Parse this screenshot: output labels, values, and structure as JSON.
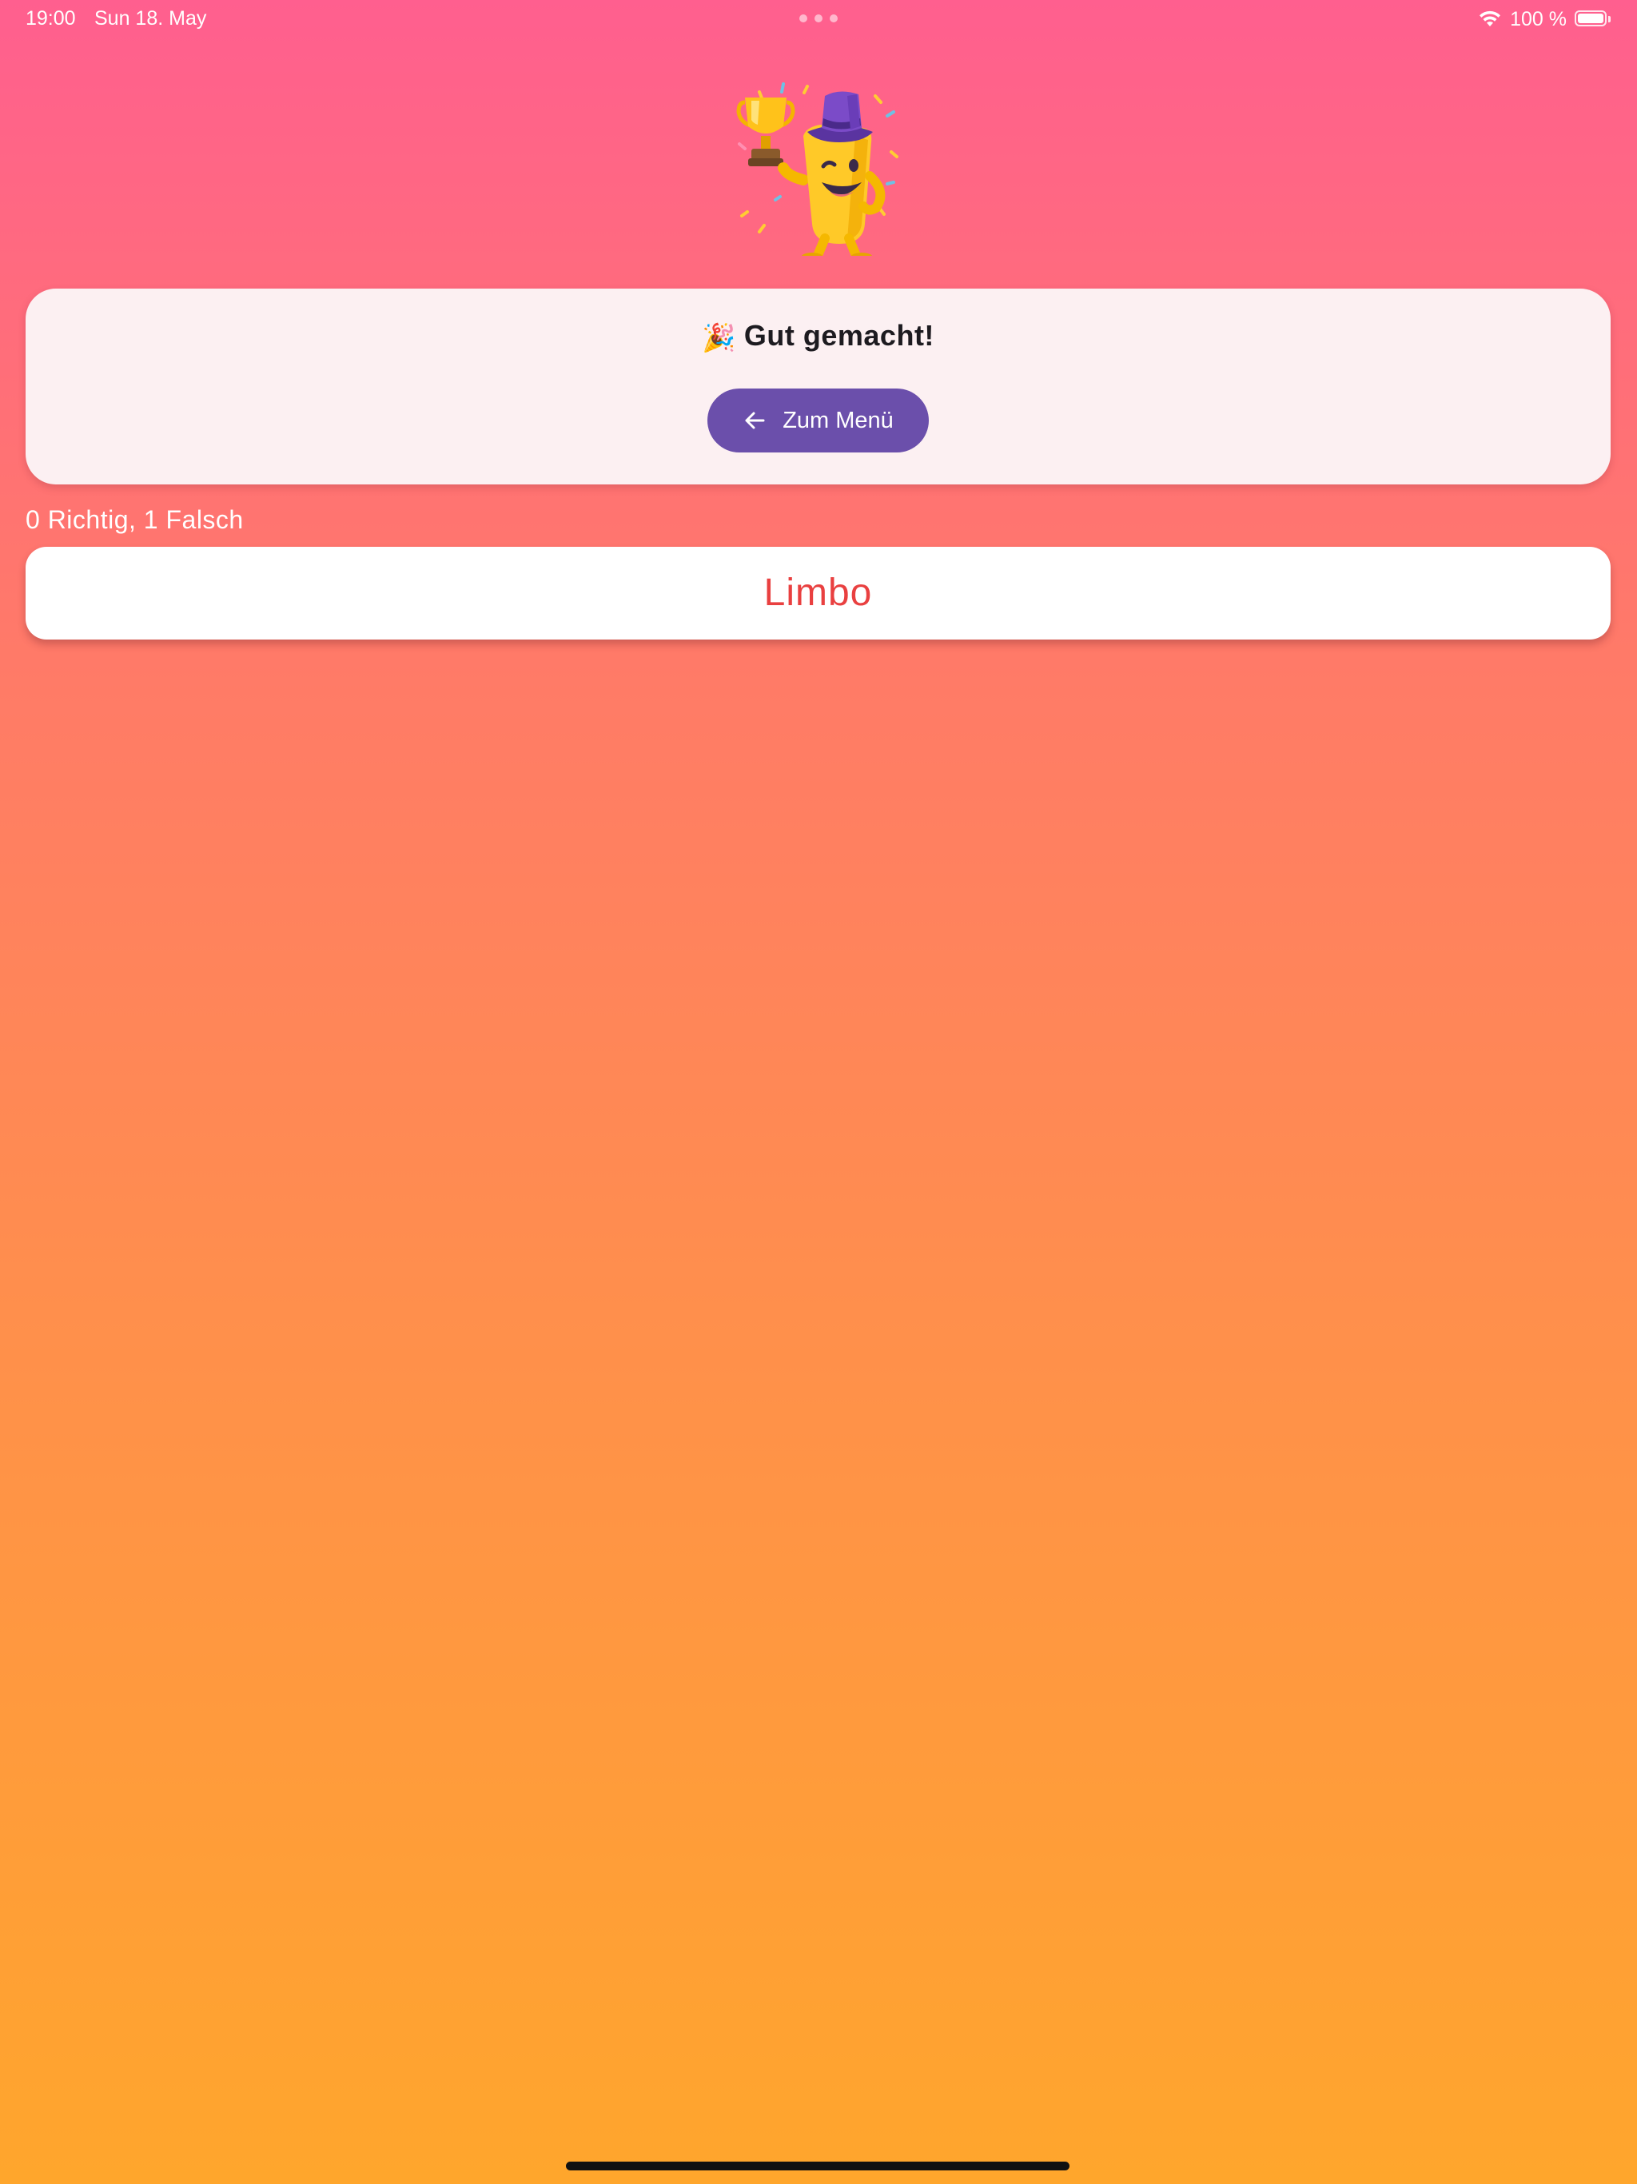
{
  "status_bar": {
    "time": "19:00",
    "date": "Sun 18. May",
    "battery_label": "100 %",
    "battery_level": 1.0
  },
  "mascot": {
    "icon": "trophy-mascot-icon"
  },
  "result_card": {
    "emoji": "🎉",
    "title": "Gut gemacht!",
    "menu_button_label": "Zum Menü",
    "menu_button_icon": "arrow-back-icon"
  },
  "score": {
    "text": "0 Richtig, 1 Falsch"
  },
  "word_card": {
    "word": "Limbo"
  },
  "colors": {
    "gradient_top": "#ff5f8f",
    "gradient_bottom": "#ffa62c",
    "button": "#6b4fab",
    "wrong_word": "#e94040",
    "card": "#fcf0f2"
  }
}
